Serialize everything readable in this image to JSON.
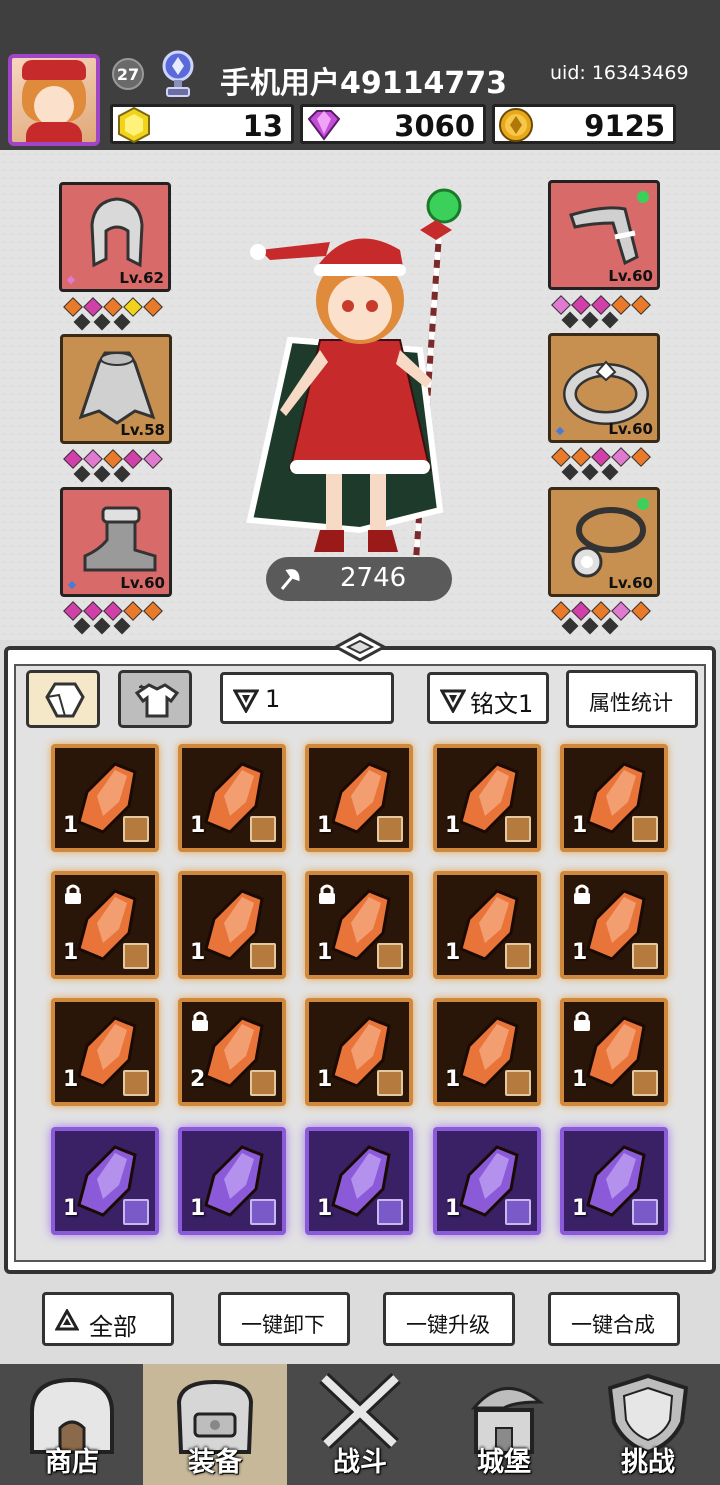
{
  "player": {
    "level": "27",
    "name": "手机用户49114773",
    "uid": "uid: 16343469"
  },
  "resources": [
    {
      "icon": "yellow-gem-icon",
      "value": "13",
      "color": "#f2d21a"
    },
    {
      "icon": "purple-diamond-icon",
      "value": "3060",
      "color": "#c24fd6"
    },
    {
      "icon": "gold-coin-icon",
      "value": "9125",
      "color": "#e8a81a"
    }
  ],
  "equipment": {
    "left": [
      {
        "name": "helmet",
        "level": "Lv.62",
        "frame": "red"
      },
      {
        "name": "cape",
        "level": "Lv.58",
        "frame": "gold"
      },
      {
        "name": "boots",
        "level": "Lv.60",
        "frame": "red"
      }
    ],
    "right": [
      {
        "name": "weapon",
        "level": "Lv.60",
        "frame": "red"
      },
      {
        "name": "ring",
        "level": "Lv.60",
        "frame": "gold"
      },
      {
        "name": "necklace",
        "level": "Lv.60",
        "frame": "gold"
      }
    ],
    "power": "2746"
  },
  "inventory": {
    "filter_level": "1",
    "filter_rune": "铭文1",
    "stats_button": "属性统计",
    "items": [
      {
        "count": "1",
        "rarity": "orange",
        "locked": false
      },
      {
        "count": "1",
        "rarity": "orange",
        "locked": false
      },
      {
        "count": "1",
        "rarity": "orange",
        "locked": false
      },
      {
        "count": "1",
        "rarity": "orange",
        "locked": false
      },
      {
        "count": "1",
        "rarity": "orange",
        "locked": false
      },
      {
        "count": "1",
        "rarity": "orange",
        "locked": true
      },
      {
        "count": "1",
        "rarity": "orange",
        "locked": false
      },
      {
        "count": "1",
        "rarity": "orange",
        "locked": true
      },
      {
        "count": "1",
        "rarity": "orange",
        "locked": false
      },
      {
        "count": "1",
        "rarity": "orange",
        "locked": true
      },
      {
        "count": "1",
        "rarity": "orange",
        "locked": false
      },
      {
        "count": "2",
        "rarity": "orange",
        "locked": true
      },
      {
        "count": "1",
        "rarity": "orange",
        "locked": false
      },
      {
        "count": "1",
        "rarity": "orange",
        "locked": false
      },
      {
        "count": "1",
        "rarity": "orange",
        "locked": true
      },
      {
        "count": "1",
        "rarity": "purple",
        "locked": false
      },
      {
        "count": "1",
        "rarity": "purple",
        "locked": false
      },
      {
        "count": "1",
        "rarity": "purple",
        "locked": false
      },
      {
        "count": "1",
        "rarity": "purple",
        "locked": false
      },
      {
        "count": "1",
        "rarity": "purple",
        "locked": false
      }
    ]
  },
  "actions": {
    "all": "全部",
    "unequip_all": "一键卸下",
    "upgrade_all": "一键升级",
    "merge_all": "一键合成"
  },
  "nav": [
    {
      "label": "商店",
      "icon": "shop-icon",
      "active": false
    },
    {
      "label": "装备",
      "icon": "backpack-icon",
      "active": true
    },
    {
      "label": "战斗",
      "icon": "crossed-swords-icon",
      "active": false
    },
    {
      "label": "城堡",
      "icon": "castle-icon",
      "active": false
    },
    {
      "label": "挑战",
      "icon": "shield-icon",
      "active": false
    }
  ]
}
